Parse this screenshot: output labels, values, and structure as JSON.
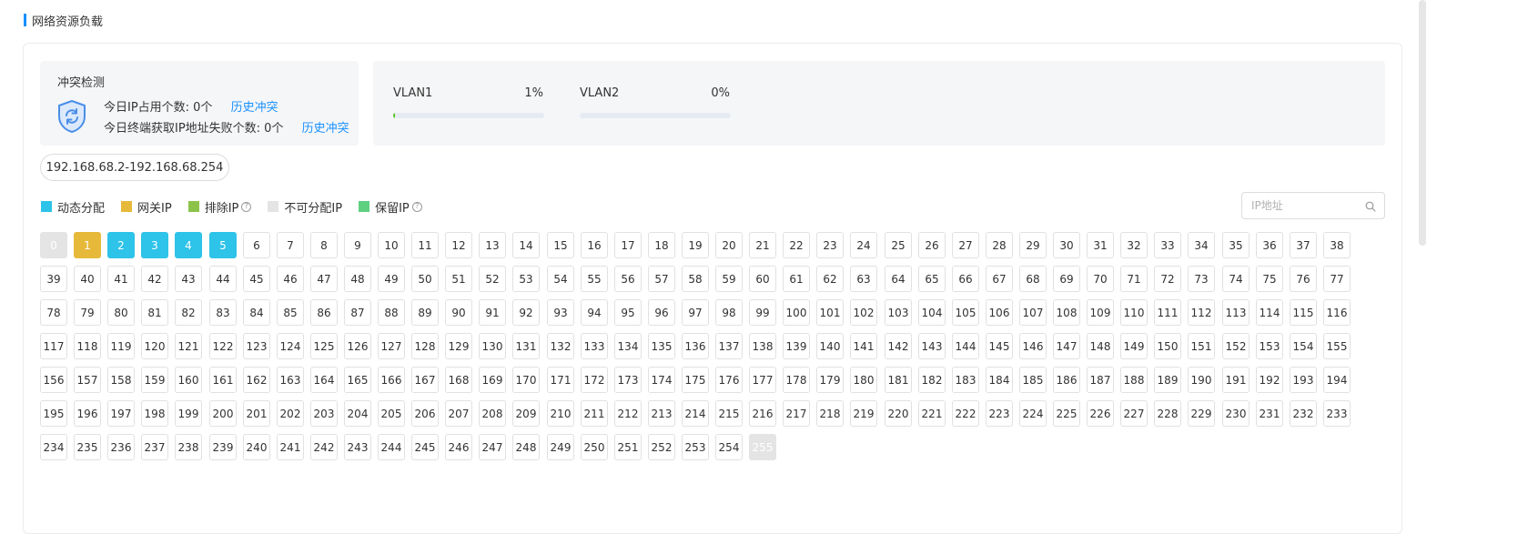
{
  "section": {
    "title": "网络资源负载"
  },
  "conflict": {
    "title": "冲突检测",
    "icon": "shield-refresh-icon",
    "ip_used_label": "今日IP占用个数: 0个",
    "ip_fail_label": "今日终端获取IP地址失败个数: 0个",
    "history_link_1": "历史冲突",
    "history_link_2": "历史冲突"
  },
  "vlans": [
    {
      "name": "VLAN1",
      "percent": "1%",
      "usage": 1,
      "active": true
    },
    {
      "name": "VLAN2",
      "percent": "0%",
      "usage": 0,
      "active": false
    }
  ],
  "range": {
    "label": "192.168.68.2-192.168.68.254"
  },
  "legend": [
    {
      "label": "动态分配",
      "color": "#2ec3e8",
      "help": false
    },
    {
      "label": "网关IP",
      "color": "#e6b93a",
      "help": false
    },
    {
      "label": "排除IP",
      "color": "#8bc34a",
      "help": true,
      "help_glyph": "?"
    },
    {
      "label": "不可分配IP",
      "color": "#e4e4e4",
      "help": false
    },
    {
      "label": "保留IP",
      "color": "#5fcf80",
      "help": true,
      "help_glyph": "?"
    }
  ],
  "search": {
    "placeholder": "IP地址",
    "icon": "search-icon"
  },
  "ip_grid": {
    "first": 0,
    "last": 255,
    "columns": 39,
    "states": {
      "0": "unavailable",
      "1": "gateway",
      "2": "dynamic",
      "3": "dynamic",
      "4": "dynamic",
      "5": "dynamic",
      "255": "unavailable"
    }
  },
  "colors": {
    "accent": "#1890ff",
    "dynamic": "#2ec3e8",
    "gateway": "#e6b93a",
    "excluded": "#8bc34a",
    "unavailable": "#e4e4e4",
    "reserved": "#5fcf80"
  }
}
